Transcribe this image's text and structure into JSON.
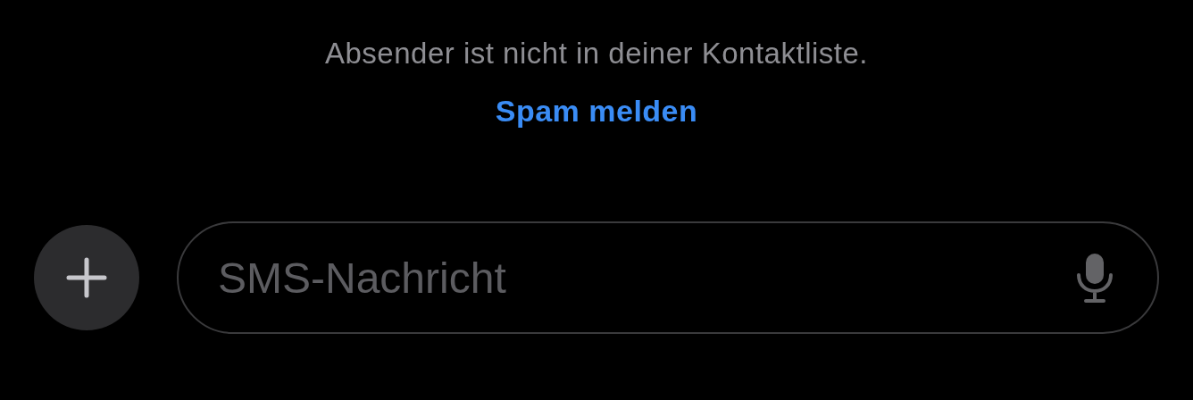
{
  "notice": {
    "text": "Absender ist nicht in deiner Kontaktliste.",
    "link": "Spam melden"
  },
  "composer": {
    "placeholder": "SMS-Nachricht"
  }
}
